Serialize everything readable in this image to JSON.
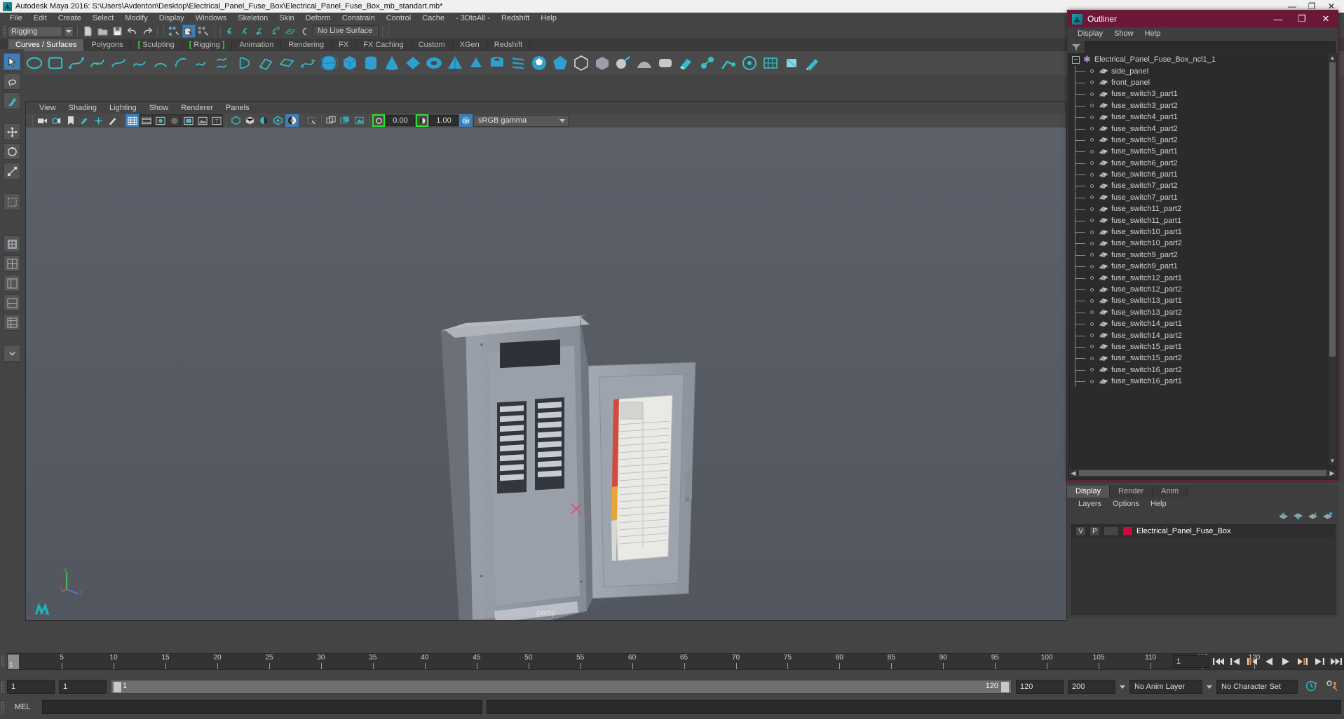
{
  "window": {
    "title": "Autodesk Maya 2016: S:\\Users\\Avdenton\\Desktop\\Electrical_Panel_Fuse_Box\\Electrical_Panel_Fuse_Box_mb_standart.mb*",
    "minimize": "—",
    "maximize": "❐",
    "close": "✕",
    "app_icon": "maya-icon"
  },
  "menubar": {
    "items": [
      {
        "label": "File"
      },
      {
        "label": "Edit"
      },
      {
        "label": "Create"
      },
      {
        "label": "Select"
      },
      {
        "label": "Modify"
      },
      {
        "label": "Display"
      },
      {
        "label": "Windows"
      },
      {
        "label": "Skeleton"
      },
      {
        "label": "Skin"
      },
      {
        "label": "Deform"
      },
      {
        "label": "Constrain"
      },
      {
        "label": "Control"
      },
      {
        "label": "Cache"
      },
      {
        "label": "- 3DtoAll -"
      },
      {
        "label": "Redshift"
      },
      {
        "label": "Help"
      }
    ]
  },
  "statusbar": {
    "menuset": "Rigging",
    "live_surface": "No Live Surface"
  },
  "shelf": {
    "tabs": [
      {
        "label": "Curves / Surfaces",
        "active": true,
        "bracket": ""
      },
      {
        "label": "Polygons",
        "active": false,
        "bracket": ""
      },
      {
        "label": "Sculpting",
        "active": false,
        "bracket": "left"
      },
      {
        "label": "Rigging",
        "active": false,
        "bracket": "both"
      },
      {
        "label": "Animation",
        "active": false,
        "bracket": ""
      },
      {
        "label": "Rendering",
        "active": false,
        "bracket": ""
      },
      {
        "label": "FX",
        "active": false,
        "bracket": ""
      },
      {
        "label": "FX Caching",
        "active": false,
        "bracket": ""
      },
      {
        "label": "Custom",
        "active": false,
        "bracket": ""
      },
      {
        "label": "XGen",
        "active": false,
        "bracket": ""
      },
      {
        "label": "Redshift",
        "active": false,
        "bracket": ""
      }
    ]
  },
  "viewport": {
    "menus": [
      {
        "label": "View"
      },
      {
        "label": "Shading"
      },
      {
        "label": "Lighting"
      },
      {
        "label": "Show"
      },
      {
        "label": "Renderer"
      },
      {
        "label": "Panels"
      }
    ],
    "exposure": "0.00",
    "gamma": "1.00",
    "color_management": "sRGB gamma",
    "cm_toggle": "ON",
    "camera_label": "persp",
    "axis_labels": {
      "y": "Y",
      "z": "Z",
      "x": "X"
    }
  },
  "timeline": {
    "current_frame": "1",
    "start_field": "1",
    "end_field": "1",
    "range_start": "1",
    "range_end": "120",
    "anim_end": "120",
    "playback_end": "200",
    "anim_layer": "No Anim Layer",
    "character_set": "No Character Set",
    "tick_labels": [
      "5",
      "10",
      "15",
      "20",
      "25",
      "30",
      "35",
      "40",
      "45",
      "50",
      "55",
      "60",
      "65",
      "70",
      "75",
      "80",
      "85",
      "90",
      "95",
      "100",
      "105",
      "110",
      "115",
      "120"
    ],
    "tick_values": [
      5,
      10,
      15,
      20,
      25,
      30,
      35,
      40,
      45,
      50,
      55,
      60,
      65,
      70,
      75,
      80,
      85,
      90,
      95,
      100,
      105,
      110,
      115,
      120
    ],
    "min": 1,
    "max": 120,
    "playback_buttons": [
      {
        "name": "go-to-start"
      },
      {
        "name": "step-back-key"
      },
      {
        "name": "step-back-frame"
      },
      {
        "name": "play-backwards"
      },
      {
        "name": "play-forwards"
      },
      {
        "name": "step-forward-frame"
      },
      {
        "name": "step-forward-key"
      },
      {
        "name": "go-to-end"
      }
    ]
  },
  "command_line": {
    "language": "MEL",
    "input_value": "",
    "output_value": ""
  },
  "outliner": {
    "title": "Outliner",
    "minimize": "—",
    "maximize": "❐",
    "close": "✕",
    "menus": [
      {
        "label": "Display"
      },
      {
        "label": "Show"
      },
      {
        "label": "Help"
      }
    ],
    "search_value": "",
    "root": {
      "label": "Electrical_Panel_Fuse_Box_ncl1_1",
      "expander": "−"
    },
    "items": [
      {
        "label": "side_panel"
      },
      {
        "label": "front_panel"
      },
      {
        "label": "fuse_switch3_part1"
      },
      {
        "label": "fuse_switch3_part2"
      },
      {
        "label": "fuse_switch4_part1"
      },
      {
        "label": "fuse_switch4_part2"
      },
      {
        "label": "fuse_switch5_part2"
      },
      {
        "label": "fuse_switch5_part1"
      },
      {
        "label": "fuse_switch6_part2"
      },
      {
        "label": "fuse_switch6_part1"
      },
      {
        "label": "fuse_switch7_part2"
      },
      {
        "label": "fuse_switch7_part1"
      },
      {
        "label": "fuse_switch11_part2"
      },
      {
        "label": "fuse_switch11_part1"
      },
      {
        "label": "fuse_switch10_part1"
      },
      {
        "label": "fuse_switch10_part2"
      },
      {
        "label": "fuse_switch9_part2"
      },
      {
        "label": "fuse_switch9_part1"
      },
      {
        "label": "fuse_switch12_part1"
      },
      {
        "label": "fuse_switch12_part2"
      },
      {
        "label": "fuse_switch13_part1"
      },
      {
        "label": "fuse_switch13_part2"
      },
      {
        "label": "fuse_switch14_part1"
      },
      {
        "label": "fuse_switch14_part2"
      },
      {
        "label": "fuse_switch15_part1"
      },
      {
        "label": "fuse_switch15_part2"
      },
      {
        "label": "fuse_switch16_part2"
      },
      {
        "label": "fuse_switch16_part1"
      }
    ]
  },
  "layer_editor": {
    "tabs": [
      {
        "label": "Display",
        "active": true
      },
      {
        "label": "Render",
        "active": false
      },
      {
        "label": "Anim",
        "active": false
      }
    ],
    "menus": [
      {
        "label": "Layers"
      },
      {
        "label": "Options"
      },
      {
        "label": "Help"
      }
    ],
    "layers": [
      {
        "visibility": "V",
        "playback": "P",
        "color": "#c40d40",
        "name": "Electrical_Panel_Fuse_Box"
      }
    ]
  },
  "colors": {
    "accent_blue": "#3f7fb5",
    "title_magenta": "#6b1738",
    "shelf_green": "#2ee22e",
    "layer_red": "#c40d40",
    "icon_teal": "#35bfc9",
    "playback_orange": "#e8873a"
  }
}
